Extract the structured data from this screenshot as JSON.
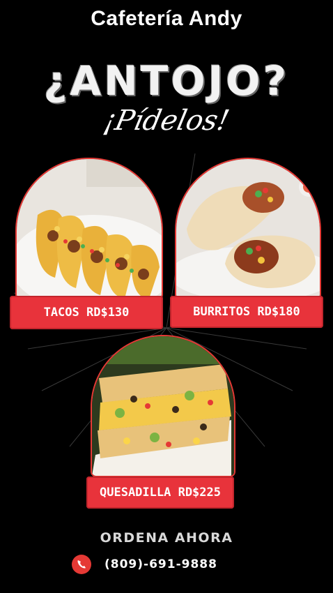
{
  "brand": {
    "name": "Cafetería Andy"
  },
  "headline": "¿ANTOJO?",
  "subheadline": "¡Pídelos!",
  "menu": [
    {
      "label": "TACOS RD$130"
    },
    {
      "label": "BURRITOS RD$180"
    },
    {
      "label": "QUESADILLA RD$225"
    }
  ],
  "cta": "ORDENA AHORA",
  "contact": {
    "phone": "(809)-691-9888",
    "icon": "phone-icon"
  },
  "colors": {
    "accent": "#e8333b",
    "background": "#000000",
    "text": "#ffffff"
  }
}
